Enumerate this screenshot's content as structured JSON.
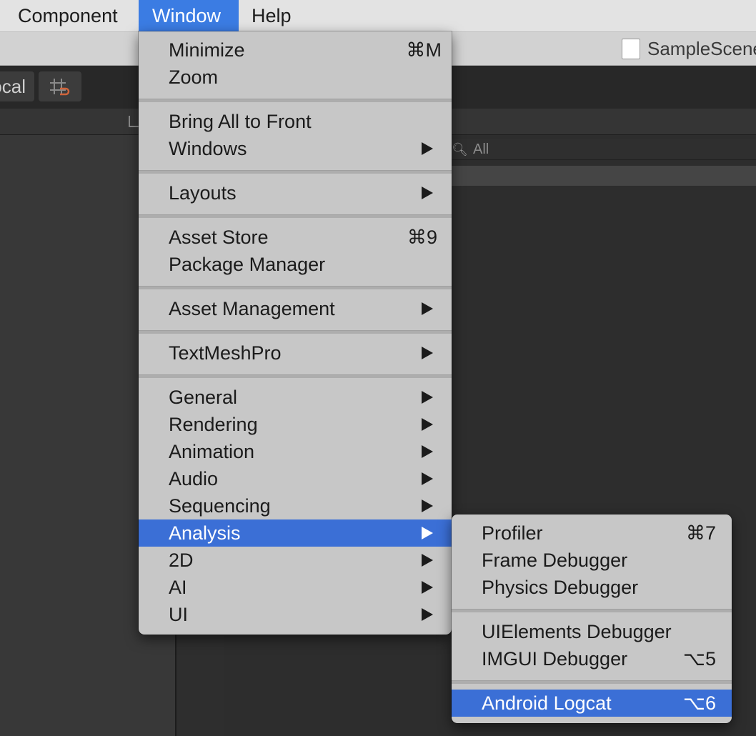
{
  "menubar": {
    "items": [
      "Component",
      "Window",
      "Help"
    ]
  },
  "editor": {
    "scene_title": "SampleScene",
    "local_label": "Local",
    "search_placeholder": "All"
  },
  "window_menu": {
    "minimize": {
      "label": "Minimize",
      "shortcut": "⌘M"
    },
    "zoom": {
      "label": "Zoom"
    },
    "bring_all": {
      "label": "Bring All to Front"
    },
    "windows": {
      "label": "Windows"
    },
    "layouts": {
      "label": "Layouts"
    },
    "asset_store": {
      "label": "Asset Store",
      "shortcut": "⌘9"
    },
    "package_manager": {
      "label": "Package Manager"
    },
    "asset_management": {
      "label": "Asset Management"
    },
    "textmeshpro": {
      "label": "TextMeshPro"
    },
    "general": {
      "label": "General"
    },
    "rendering": {
      "label": "Rendering"
    },
    "animation": {
      "label": "Animation"
    },
    "audio": {
      "label": "Audio"
    },
    "sequencing": {
      "label": "Sequencing"
    },
    "analysis": {
      "label": "Analysis"
    },
    "two_d": {
      "label": "2D"
    },
    "ai": {
      "label": "AI"
    },
    "ui": {
      "label": "UI"
    }
  },
  "analysis_menu": {
    "profiler": {
      "label": "Profiler",
      "shortcut": "⌘7"
    },
    "frame_debugger": {
      "label": "Frame Debugger"
    },
    "physics_debugger": {
      "label": "Physics Debugger"
    },
    "uielements_debugger": {
      "label": "UIElements Debugger"
    },
    "imgui_debugger": {
      "label": "IMGUI Debugger",
      "shortcut": "⌥5"
    },
    "android_logcat": {
      "label": "Android Logcat",
      "shortcut": "⌥6"
    }
  },
  "colors": {
    "highlight": "#3b6fd6",
    "menu_bg": "#c7c7c7",
    "menubar_bg": "#e3e3e3",
    "editor_bg": "#2d2d2d"
  },
  "icons": [
    "unity-scene-icon",
    "snap-grid-icon",
    "lock-icon",
    "search-icon",
    "submenu-arrow-icon"
  ]
}
